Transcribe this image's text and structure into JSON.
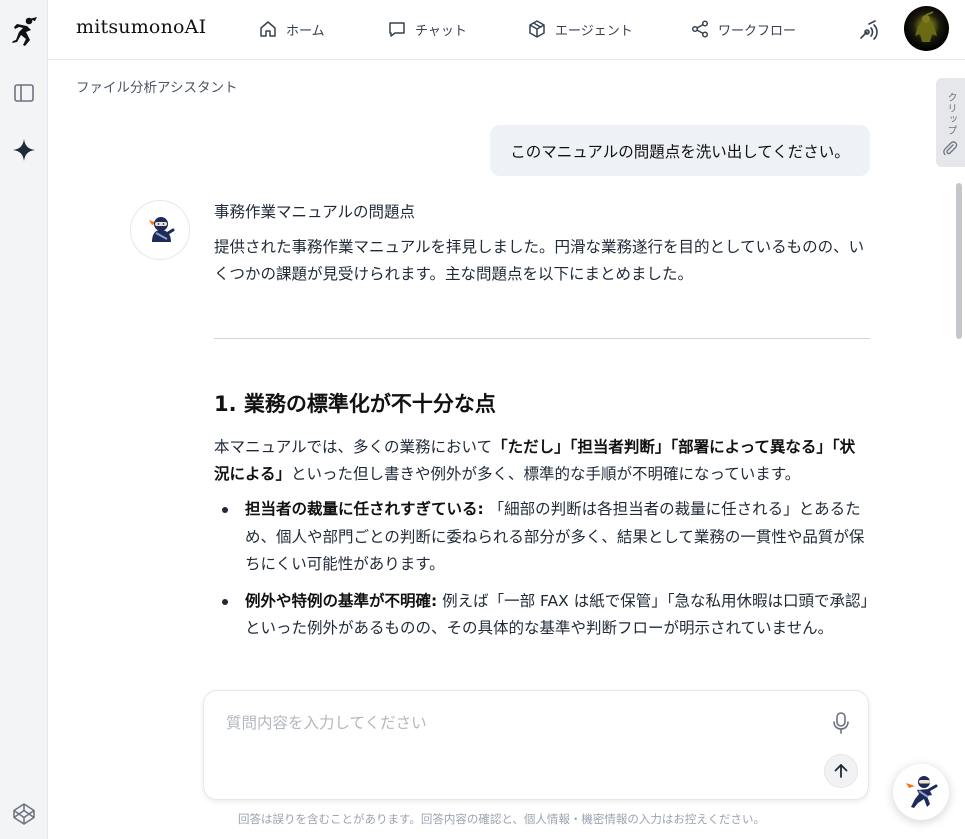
{
  "header": {
    "brand": "mitsumonoAI",
    "nav": [
      {
        "label": "ホーム",
        "icon": "home-icon"
      },
      {
        "label": "チャット",
        "icon": "chat-icon"
      },
      {
        "label": "エージェント",
        "icon": "cube-icon"
      },
      {
        "label": "ワークフロー",
        "icon": "share-icon"
      }
    ]
  },
  "breadcrumb": "ファイル分析アシスタント",
  "clip_tab": {
    "label": "クリップ"
  },
  "conversation": {
    "user_message": "このマニュアルの問題点を洗い出してください。",
    "answer": {
      "title": "事務作業マニュアルの問題点",
      "intro": "提供された事務作業マニュアルを拝見しました。円滑な業務遂行を目的としているものの、いくつかの課題が見受けられます。主な問題点を以下にまとめました。",
      "section_heading": "1. 業務の標準化が不十分な点",
      "para": {
        "before": "本マニュアルでは、多くの業務において",
        "bold": "「ただし」「担当者判断」「部署によって異なる」「状況による」",
        "after": "といった但し書きや例外が多く、標準的な手順が不明確になっています。"
      },
      "bullets": [
        {
          "bold": "担当者の裁量に任されすぎている:",
          "text": " 「細部の判断は各担当者の裁量に任される」とあるため、個人や部門ごとの判断に委ねられる部分が多く、結果として業務の一貫性や品質が保ちにくい可能性があります。"
        },
        {
          "bold": "例外や特例の基準が不明確:",
          "text": " 例えば「一部 FAX は紙で保管」「急な私用休暇は口頭で承認」といった例外があるものの、その具体的な基準や判断フローが明示されていません。"
        }
      ]
    }
  },
  "composer": {
    "placeholder": "質問内容を入力してください",
    "value": ""
  },
  "disclaimer": "回答は誤りを含むことがあります。回答内容の確認と、個人情報・機密情報の入力はお控えください。",
  "colors": {
    "accent": "#f97316",
    "navy": "#1e2a5a"
  }
}
